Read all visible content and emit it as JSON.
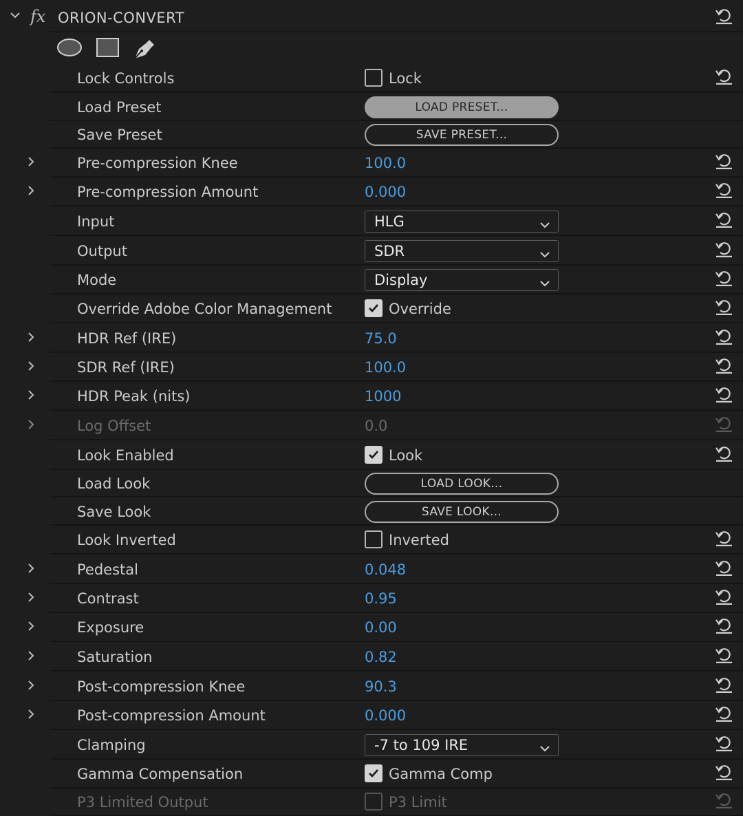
{
  "effect": {
    "title": "ORION-CONVERT",
    "fx_label": "fx"
  },
  "mask_tools": [
    {
      "icon": "ellipse-mask-icon"
    },
    {
      "icon": "rectangle-mask-icon"
    },
    {
      "icon": "pen-mask-icon"
    }
  ],
  "rows": [
    {
      "label": "Lock Controls",
      "type": "checkbox",
      "checked": false,
      "text": "Lock",
      "expandable": false,
      "reset": true
    },
    {
      "label": "Load Preset",
      "type": "button",
      "text": "LOAD PRESET...",
      "pressed": true,
      "expandable": false,
      "reset": false
    },
    {
      "label": "Save Preset",
      "type": "button",
      "text": "SAVE PRESET...",
      "pressed": false,
      "expandable": false,
      "reset": false
    },
    {
      "label": "Pre-compression Knee",
      "type": "number",
      "value": "100.0",
      "expandable": true,
      "reset": true
    },
    {
      "label": "Pre-compression Amount",
      "type": "number",
      "value": "0.000",
      "expandable": true,
      "reset": true
    },
    {
      "label": "Input",
      "type": "dropdown",
      "value": "HLG",
      "expandable": false,
      "reset": true
    },
    {
      "label": "Output",
      "type": "dropdown",
      "value": "SDR",
      "expandable": false,
      "reset": true
    },
    {
      "label": "Mode",
      "type": "dropdown",
      "value": "Display",
      "expandable": false,
      "reset": true
    },
    {
      "label": "Override Adobe Color Management",
      "type": "checkbox",
      "checked": true,
      "text": "Override",
      "expandable": false,
      "reset": true
    },
    {
      "label": "HDR Ref (IRE)",
      "type": "number",
      "value": "75.0",
      "expandable": true,
      "reset": true
    },
    {
      "label": "SDR Ref (IRE)",
      "type": "number",
      "value": "100.0",
      "expandable": true,
      "reset": true
    },
    {
      "label": "HDR Peak (nits)",
      "type": "number",
      "value": "1000",
      "expandable": true,
      "reset": true
    },
    {
      "label": "Log Offset",
      "type": "number",
      "value": "0.0",
      "expandable": true,
      "reset": true,
      "disabled": true
    },
    {
      "label": "Look Enabled",
      "type": "checkbox",
      "checked": true,
      "text": "Look",
      "expandable": false,
      "reset": true
    },
    {
      "label": "Load Look",
      "type": "button",
      "text": "LOAD LOOK...",
      "pressed": false,
      "expandable": false,
      "reset": false
    },
    {
      "label": "Save Look",
      "type": "button",
      "text": "SAVE LOOK...",
      "pressed": false,
      "expandable": false,
      "reset": false
    },
    {
      "label": "Look Inverted",
      "type": "checkbox",
      "checked": false,
      "text": "Inverted",
      "expandable": false,
      "reset": true
    },
    {
      "label": "Pedestal",
      "type": "number",
      "value": "0.048",
      "expandable": true,
      "reset": true
    },
    {
      "label": "Contrast",
      "type": "number",
      "value": "0.95",
      "expandable": true,
      "reset": true
    },
    {
      "label": "Exposure",
      "type": "number",
      "value": "0.00",
      "expandable": true,
      "reset": true
    },
    {
      "label": "Saturation",
      "type": "number",
      "value": "0.82",
      "expandable": true,
      "reset": true
    },
    {
      "label": "Post-compression Knee",
      "type": "number",
      "value": "90.3",
      "expandable": true,
      "reset": true
    },
    {
      "label": "Post-compression Amount",
      "type": "number",
      "value": "0.000",
      "expandable": true,
      "reset": true
    },
    {
      "label": "Clamping",
      "type": "dropdown",
      "value": "-7 to 109 IRE",
      "expandable": false,
      "reset": true
    },
    {
      "label": "Gamma Compensation",
      "type": "checkbox",
      "checked": true,
      "text": "Gamma Comp",
      "expandable": false,
      "reset": true
    },
    {
      "label": "P3 Limited Output",
      "type": "checkbox",
      "checked": false,
      "text": "P3 Limit",
      "expandable": false,
      "reset": true,
      "disabled": true
    }
  ],
  "colors": {
    "background": "#1e1e1e",
    "value_blue": "#4a9de0",
    "separator": "#141414"
  }
}
